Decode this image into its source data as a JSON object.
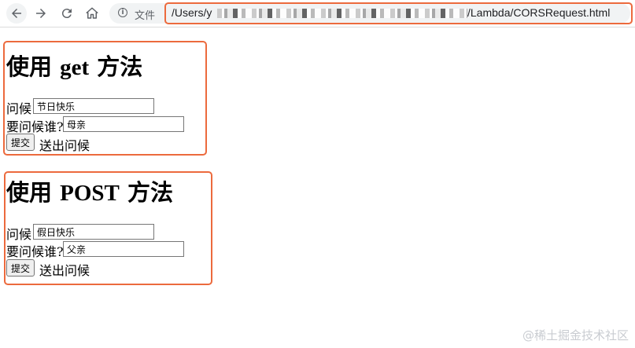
{
  "browser": {
    "file_label": "文件",
    "url_prefix": "/Users/y",
    "url_suffix": "/Lambda/CORSRequest.html",
    "highlight_color": "#ec6a3d"
  },
  "forms": [
    {
      "heading_cn_start": "使用",
      "heading_method": "get",
      "heading_cn_end": "方法",
      "greeting_label": "问候",
      "greeting_value": "节日快乐",
      "recipient_label": "要问候谁?",
      "recipient_value": "母亲",
      "submit_label": "提交",
      "after_submit_text": "送出问候"
    },
    {
      "heading_cn_start": "使用",
      "heading_method": "POST",
      "heading_cn_end": "方法",
      "greeting_label": "问候",
      "greeting_value": "假日快乐",
      "recipient_label": "要问候谁?",
      "recipient_value": "父亲",
      "submit_label": "提交",
      "after_submit_text": "送出问候"
    }
  ],
  "watermark": "@稀土掘金技术社区"
}
